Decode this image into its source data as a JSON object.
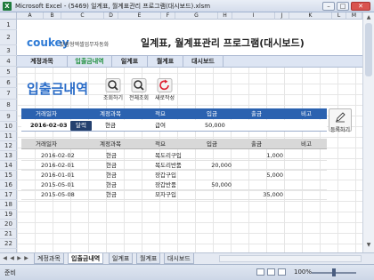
{
  "window": {
    "app_icon": "X",
    "title": "Microsoft Excel - (5469) 일계표, 월계표관리 프로그램(대시보드).xlsm",
    "minimize": "–",
    "maximize": "□",
    "close": "✕"
  },
  "columns": [
    "A",
    "B",
    "C",
    "D",
    "E",
    "F",
    "G",
    "H",
    "I",
    "J",
    "K",
    "L",
    "M"
  ],
  "rows": [
    "1",
    "2",
    "3",
    "4",
    "5",
    "6",
    "7",
    "8",
    "9",
    "10",
    "11",
    "12",
    "13",
    "14",
    "15",
    "16",
    "17",
    "18",
    "19",
    "20",
    "21",
    "22"
  ],
  "brand": {
    "logo": "coukey",
    "tagline": "맞춤형엑셀업무자동화"
  },
  "doc_title": "일계표, 월계표관리 프로그램(대시보드)",
  "nav": [
    {
      "label": "계정과목"
    },
    {
      "label": "입출금내역"
    },
    {
      "label": "일계표"
    },
    {
      "label": "월계표"
    },
    {
      "label": "대시보드"
    }
  ],
  "section_title": "입출금내역",
  "actions": {
    "search": "조회하기",
    "search_all": "전체조회",
    "new": "새로작성",
    "save": "등록하기"
  },
  "input_table": {
    "headers": [
      "거래일자",
      "계정과목",
      "적요",
      "입금",
      "출금",
      "비고"
    ],
    "row": {
      "date": "2016-02-03",
      "calendar": "달력",
      "account": "현금",
      "memo": "급여",
      "deposit": "50,000",
      "withdraw": "",
      "note": ""
    }
  },
  "list_table": {
    "headers": [
      "거래일자",
      "계정과목",
      "적요",
      "입금",
      "출금",
      "비고"
    ],
    "rows": [
      {
        "date": "2016-02-02",
        "account": "현금",
        "memo": "목도리구입",
        "deposit": "",
        "withdraw": "1,000"
      },
      {
        "date": "2016-02-01",
        "account": "현금",
        "memo": "목도리반품",
        "deposit": "20,000",
        "withdraw": ""
      },
      {
        "date": "2016-01-01",
        "account": "현금",
        "memo": "장갑구입",
        "deposit": "",
        "withdraw": "5,000"
      },
      {
        "date": "2015-05-01",
        "account": "현금",
        "memo": "장갑반품",
        "deposit": "50,000",
        "withdraw": ""
      },
      {
        "date": "2015-05-08",
        "account": "현금",
        "memo": "모자구입",
        "deposit": "",
        "withdraw": "35,000"
      }
    ]
  },
  "sheet_tabs": [
    "계정과목",
    "입출금내역",
    "일계표",
    "월계표",
    "대시보드"
  ],
  "tab_nav": [
    "◀",
    "◀",
    "▶",
    "▶"
  ],
  "status": {
    "ready": "준비",
    "zoom": "100%"
  }
}
